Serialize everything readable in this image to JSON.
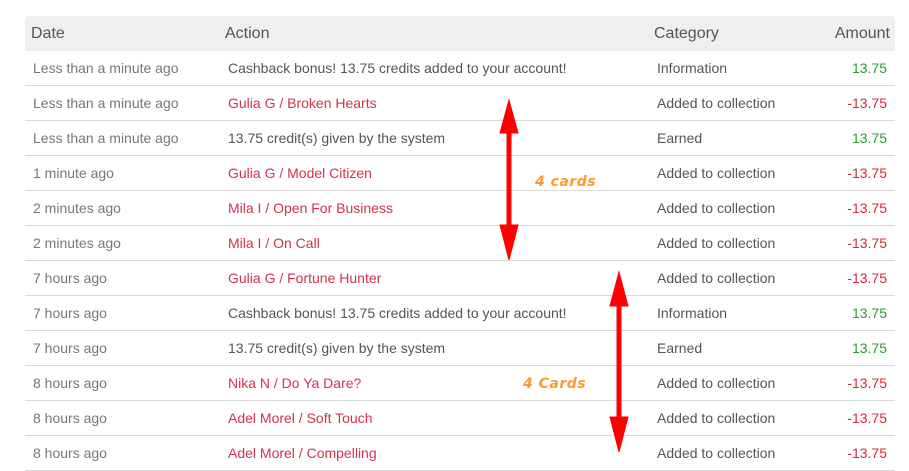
{
  "headers": {
    "date": "Date",
    "action": "Action",
    "category": "Category",
    "amount": "Amount"
  },
  "rows": [
    {
      "date": "Less than a minute ago",
      "action": "Cashback bonus! 13.75 credits added to your account!",
      "link": false,
      "category": "Information",
      "amount": "13.75",
      "sign": "pos"
    },
    {
      "date": "Less than a minute ago",
      "action": "Gulia G / Broken Hearts",
      "link": true,
      "category": "Added to collection",
      "amount": "-13.75",
      "sign": "neg"
    },
    {
      "date": "Less than a minute ago",
      "action": "13.75 credit(s) given by the system",
      "link": false,
      "category": "Earned",
      "amount": "13.75",
      "sign": "pos"
    },
    {
      "date": "1 minute ago",
      "action": "Gulia G / Model Citizen",
      "link": true,
      "category": "Added to collection",
      "amount": "-13.75",
      "sign": "neg"
    },
    {
      "date": "2 minutes ago",
      "action": "Mila I / Open For Business",
      "link": true,
      "category": "Added to collection",
      "amount": "-13.75",
      "sign": "neg"
    },
    {
      "date": "2 minutes ago",
      "action": "Mila I / On Call",
      "link": true,
      "category": "Added to collection",
      "amount": "-13.75",
      "sign": "neg"
    },
    {
      "date": "7 hours ago",
      "action": "Gulia G / Fortune Hunter",
      "link": true,
      "category": "Added to collection",
      "amount": "-13.75",
      "sign": "neg"
    },
    {
      "date": "7 hours ago",
      "action": "Cashback bonus! 13.75 credits added to your account!",
      "link": false,
      "category": "Information",
      "amount": "13.75",
      "sign": "pos"
    },
    {
      "date": "7 hours ago",
      "action": "13.75 credit(s) given by the system",
      "link": false,
      "category": "Earned",
      "amount": "13.75",
      "sign": "pos"
    },
    {
      "date": "8 hours ago",
      "action": "Nika N / Do Ya Dare?",
      "link": true,
      "category": "Added to collection",
      "amount": "-13.75",
      "sign": "neg"
    },
    {
      "date": "8 hours ago",
      "action": "Adel Morel / Soft Touch",
      "link": true,
      "category": "Added to collection",
      "amount": "-13.75",
      "sign": "neg"
    },
    {
      "date": "8 hours ago",
      "action": "Adel Morel / Compelling",
      "link": true,
      "category": "Added to collection",
      "amount": "-13.75",
      "sign": "neg"
    }
  ],
  "annotations": {
    "first": "4 cards",
    "second": "4 Cards"
  },
  "colors": {
    "positive": "#2e9b2e",
    "negative": "#d8283a",
    "link": "#d0334f",
    "annotation": "#ff9a2e",
    "arrow": "#ff0000"
  }
}
